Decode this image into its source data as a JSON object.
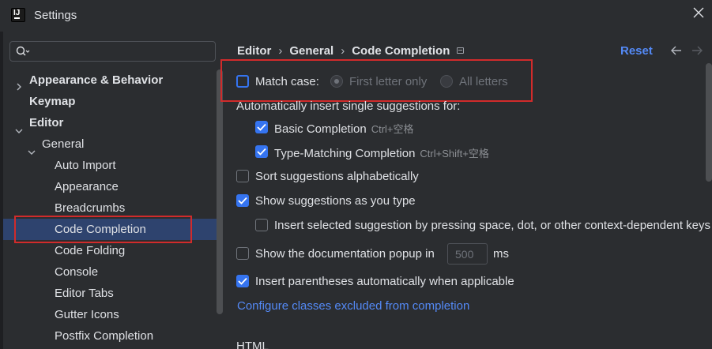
{
  "window": {
    "title": "Settings",
    "app_icon": "intellij-idea-icon",
    "close_icon": "close-icon"
  },
  "search": {
    "placeholder": "",
    "value": "",
    "icon": "search-icon"
  },
  "tree": [
    {
      "label": "Appearance & Behavior",
      "bold": true,
      "expandable": true,
      "expanded": false
    },
    {
      "label": "Keymap",
      "bold": true,
      "expandable": false
    },
    {
      "label": "Editor",
      "bold": true,
      "expandable": true,
      "expanded": true
    },
    {
      "label": "General",
      "bold": false,
      "expandable": true,
      "expanded": true
    },
    {
      "label": "Auto Import"
    },
    {
      "label": "Appearance"
    },
    {
      "label": "Breadcrumbs"
    },
    {
      "label": "Code Completion",
      "selected": true
    },
    {
      "label": "Code Folding"
    },
    {
      "label": "Console"
    },
    {
      "label": "Editor Tabs"
    },
    {
      "label": "Gutter Icons"
    },
    {
      "label": "Postfix Completion"
    }
  ],
  "breadcrumb": {
    "items": [
      "Editor",
      "General",
      "Code Completion"
    ],
    "separator": "›"
  },
  "header": {
    "reset_label": "Reset",
    "back_icon": "arrow-left-icon",
    "forward_icon": "arrow-right-icon"
  },
  "options": {
    "match_case": {
      "label": "Match case:",
      "checked": false
    },
    "first_letter": {
      "label": "First letter only",
      "selected": true,
      "enabled": false
    },
    "all_letters": {
      "label": "All letters",
      "selected": false,
      "enabled": false
    },
    "auto_insert_heading": "Automatically insert single suggestions for:",
    "basic_completion": {
      "label": "Basic Completion",
      "shortcut": "Ctrl+空格",
      "checked": true
    },
    "type_matching": {
      "label": "Type-Matching Completion",
      "shortcut": "Ctrl+Shift+空格",
      "checked": true
    },
    "sort_alpha": {
      "label": "Sort suggestions alphabetically",
      "checked": false
    },
    "show_as_type": {
      "label": "Show suggestions as you type",
      "checked": true
    },
    "insert_selected": {
      "label": "Insert selected suggestion by pressing space, dot, or other context-dependent keys",
      "checked": false
    },
    "show_doc_popup": {
      "label": "Show the documentation popup in",
      "value": "500",
      "unit": "ms",
      "checked": false
    },
    "insert_parens": {
      "label": "Insert parentheses automatically when applicable",
      "checked": true
    },
    "configure_link": "Configure classes excluded from completion",
    "section_html": "HTML"
  },
  "colors": {
    "accent": "#3574f0",
    "link": "#548af7",
    "highlight_box": "#d12b2b",
    "selection": "#2e436e"
  }
}
